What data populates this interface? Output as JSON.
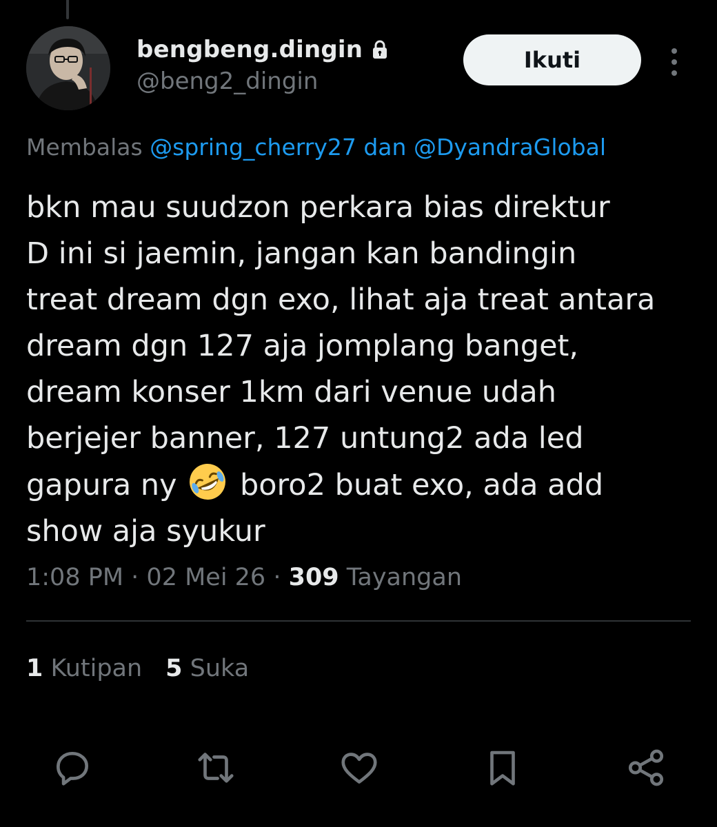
{
  "author": {
    "display_name": "bengbeng.dingin",
    "handle": "@beng2_dingin",
    "protected_icon": "lock-icon"
  },
  "follow_button": {
    "label": "Ikuti"
  },
  "reply_context": {
    "prefix": "Membalas ",
    "mention_1": "@spring_cherry27",
    "joiner": " dan ",
    "mention_2": "@DyandraGlobal"
  },
  "tweet": {
    "lines": [
      "bkn mau suudzon perkara bias direktur",
      "D ini si jaemin, jangan kan bandingin",
      "treat dream dgn exo, lihat aja treat antara",
      "dream dgn 127 aja jomplang banget,",
      "dream konser 1km dari venue udah",
      "berjejer banner, 127 untung2 ada led",
      "gapura ny",
      "boro2 buat exo, ada add",
      "show aja syukur"
    ],
    "emoji": "rolling-on-the-floor-laughing"
  },
  "meta": {
    "time": "1:08 PM",
    "separator": " · ",
    "date": "02 Mei 26",
    "views_count": "309",
    "views_label": " Tayangan"
  },
  "stats": {
    "quotes_count": "1",
    "quotes_label": " Kutipan",
    "likes_count": "5",
    "likes_label": " Suka"
  },
  "actions": [
    "reply-icon",
    "retweet-icon",
    "like-icon",
    "bookmark-icon",
    "share-icon"
  ],
  "colors": {
    "background": "#000000",
    "text_primary": "#e7e9ea",
    "text_secondary": "#71767b",
    "link": "#1d9bf0",
    "divider": "#2f3336",
    "follow_button_bg": "#eff3f4"
  }
}
